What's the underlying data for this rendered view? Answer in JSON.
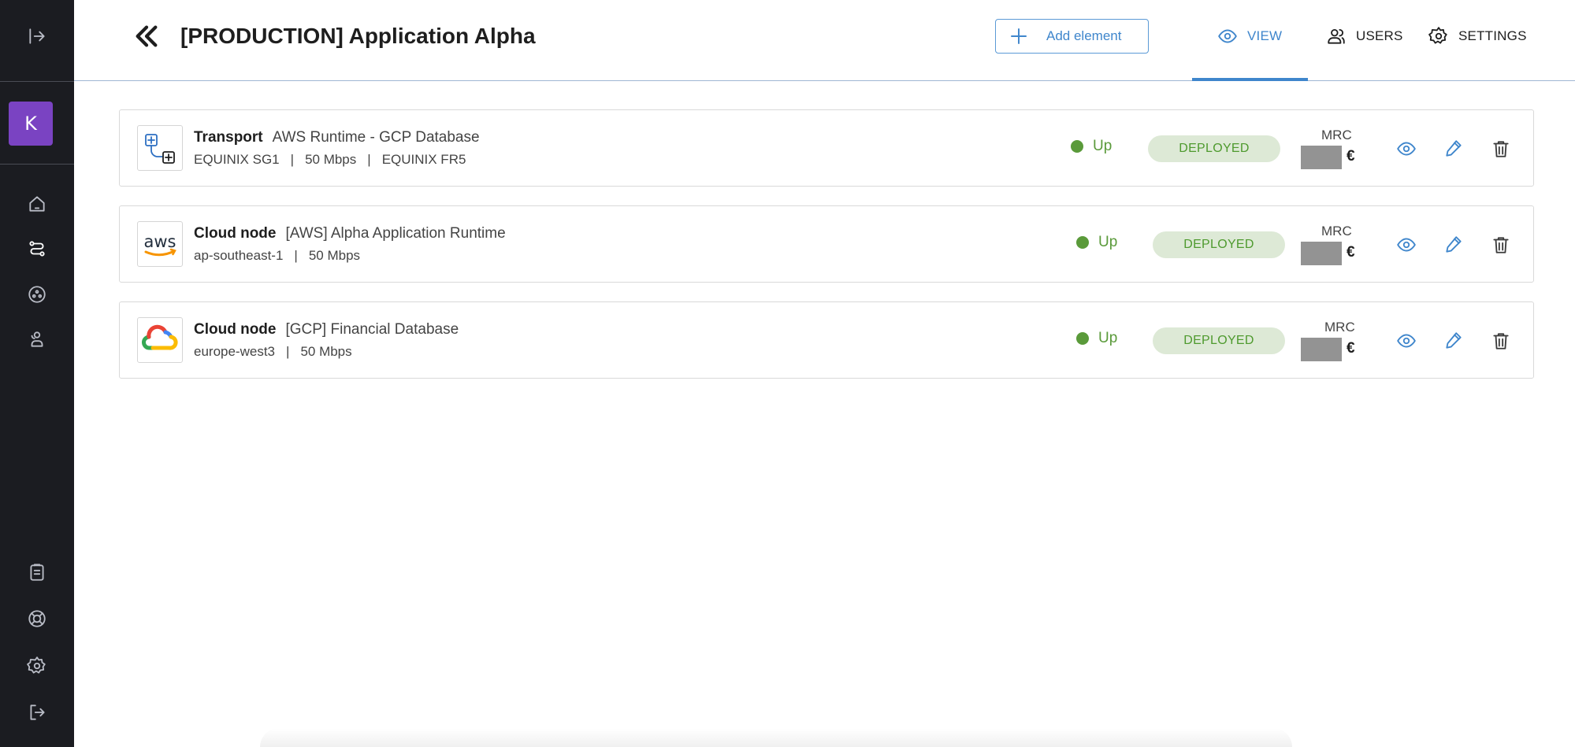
{
  "header": {
    "title": "[PRODUCTION] Application Alpha",
    "add_label": "Add element",
    "tabs": [
      {
        "label": "VIEW",
        "icon": "eye-icon",
        "active": true
      },
      {
        "label": "USERS",
        "icon": "users-icon",
        "active": false
      },
      {
        "label": "SETTINGS",
        "icon": "gear-icon",
        "active": false
      }
    ]
  },
  "sidebar": {
    "avatar_letter": "K",
    "items": [
      "expand-icon",
      "home-icon",
      "connections-icon",
      "cloud-icon",
      "users-icon",
      "clipboard-icon",
      "support-icon",
      "settings-icon",
      "logout-icon"
    ]
  },
  "colors": {
    "accent": "#3f86cc",
    "sidebar_bg": "#1b1c21",
    "avatar": "#7a43c2",
    "status_up": "#5a9a3a",
    "badge_bg": "#dde9d6"
  },
  "elements": [
    {
      "kind": "Transport",
      "name": "AWS Runtime - GCP Database",
      "details": [
        "EQUINIX SG1",
        "50 Mbps",
        "EQUINIX FR5"
      ],
      "status": "Up",
      "badge": "DEPLOYED",
      "mrc_label": "MRC",
      "currency": "€",
      "logo": "transport-icon"
    },
    {
      "kind": "Cloud node",
      "name": "[AWS] Alpha Application Runtime",
      "details": [
        "ap-southeast-1",
        "50 Mbps"
      ],
      "status": "Up",
      "badge": "DEPLOYED",
      "mrc_label": "MRC",
      "currency": "€",
      "logo": "aws-logo"
    },
    {
      "kind": "Cloud node",
      "name": "[GCP] Financial Database",
      "details": [
        "europe-west3",
        "50 Mbps"
      ],
      "status": "Up",
      "badge": "DEPLOYED",
      "mrc_label": "MRC",
      "currency": "€",
      "logo": "gcp-logo"
    }
  ]
}
